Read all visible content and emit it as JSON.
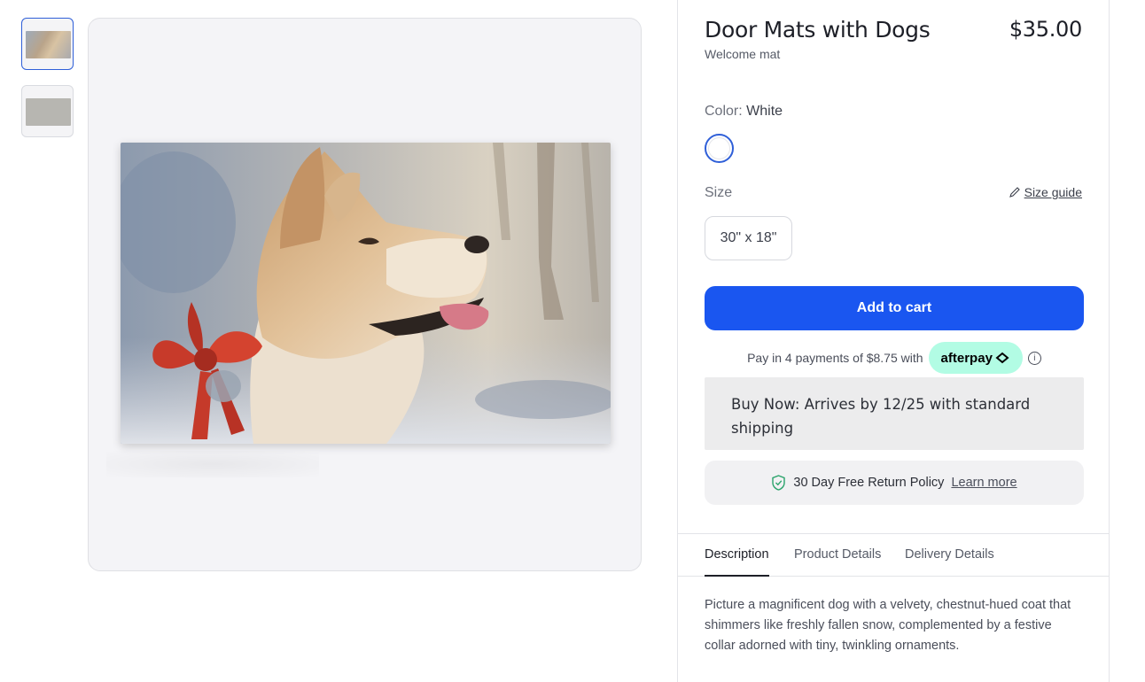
{
  "product": {
    "title": "Door Mats with Dogs",
    "subtitle": "Welcome mat",
    "price": "$35.00"
  },
  "gallery": {
    "thumbnails": [
      "thumbnail-1",
      "thumbnail-2"
    ],
    "selected_index": 0
  },
  "options": {
    "color_label": "Color:",
    "color_value": "White",
    "swatch_color": "#ffffff",
    "size_label": "Size",
    "size_guide": "Size guide",
    "size_value": "30\" x 18\""
  },
  "cart": {
    "add_to_cart": "Add to cart"
  },
  "afterpay": {
    "text": "Pay in 4 payments of $8.75 with",
    "brand": "afterpay"
  },
  "shipping": {
    "buy_now": "Buy Now: Arrives by 12/25 with standard shipping"
  },
  "returns": {
    "text": "30 Day Free Return Policy",
    "link": "Learn more"
  },
  "tabs": [
    {
      "label": "Description",
      "active": true
    },
    {
      "label": "Product Details",
      "active": false
    },
    {
      "label": "Delivery Details",
      "active": false
    }
  ],
  "description": "Picture a magnificent dog with a velvety, chestnut-hued coat that shimmers like freshly fallen snow, complemented by a festive collar adorned with tiny, twinkling ornaments.",
  "colors": {
    "accent": "#1a56f0",
    "afterpay": "#b2fce4",
    "selected_border": "#2f5fd8"
  },
  "icons": [
    "pencil-icon",
    "info-icon",
    "shield-check-icon",
    "afterpay-arrows-icon"
  ]
}
